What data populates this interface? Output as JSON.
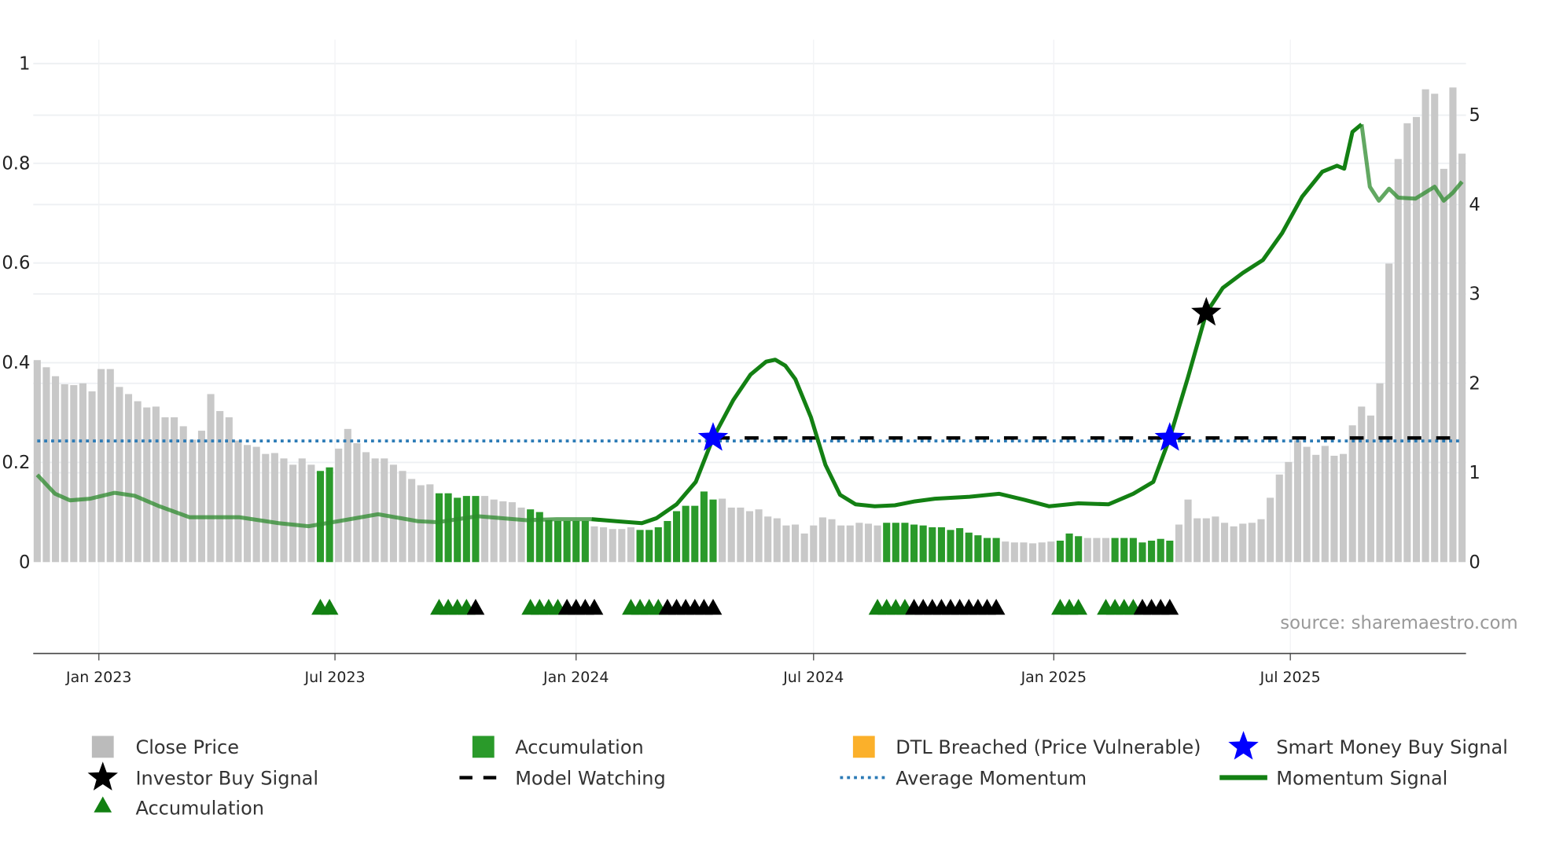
{
  "chart_data": {
    "type": "bar",
    "title": "",
    "source": "source: sharemaestro.com",
    "left_axis": {
      "label": "",
      "ylim": [
        0,
        1
      ],
      "ticks": [
        "0",
        "0.2",
        "0.4",
        "0.6",
        "0.8",
        "1"
      ],
      "tick_values": [
        0,
        0.2,
        0.4,
        0.6,
        0.8,
        1
      ]
    },
    "right_axis": {
      "label": "",
      "ylim": [
        0,
        5
      ],
      "ticks": [
        "0",
        "1",
        "2",
        "3",
        "4",
        "5"
      ],
      "tick_values": [
        0,
        1,
        2,
        3,
        4,
        5
      ]
    },
    "x_axis": {
      "unit": "week index",
      "range": [
        0,
        156
      ],
      "ticks": [
        "Jan 2023",
        "Jul 2023",
        "Jan 2024",
        "Jul 2024",
        "Jan 2025",
        "Jul 2025"
      ],
      "tick_values": [
        6.75,
        32.6,
        59.0,
        85.0,
        111.3,
        137.2
      ]
    },
    "grid": true,
    "legend_placement": "bottom",
    "colors": {
      "close": "#c8c8c8",
      "accumulation": "#2a9a2a",
      "dtl": "#fbb02a",
      "smart_money": "#0000ff",
      "investor": "#000000",
      "model_watching": "#000000",
      "avg_momentum": "#2c7bb6",
      "momentum": "#138013"
    },
    "close_price": [
      2.26,
      2.18,
      2.08,
      1.99,
      1.98,
      2.0,
      1.91,
      2.16,
      2.16,
      1.96,
      1.88,
      1.8,
      1.73,
      1.74,
      1.62,
      1.62,
      1.52,
      1.37,
      1.47,
      1.88,
      1.69,
      1.62,
      1.36,
      1.31,
      1.29,
      1.21,
      1.22,
      1.16,
      1.09,
      1.16,
      1.09,
      1.02,
      1.06,
      1.27,
      1.49,
      1.33,
      1.23,
      1.16,
      1.16,
      1.09,
      1.02,
      0.93,
      0.86,
      0.87,
      0.77,
      0.77,
      0.72,
      0.74,
      0.74,
      0.74,
      0.7,
      0.68,
      0.67,
      0.61,
      0.59,
      0.56,
      0.47,
      0.46,
      0.46,
      0.46,
      0.46,
      0.4,
      0.39,
      0.37,
      0.37,
      0.39,
      0.36,
      0.36,
      0.39,
      0.46,
      0.57,
      0.63,
      0.63,
      0.79,
      0.7,
      0.71,
      0.61,
      0.61,
      0.57,
      0.59,
      0.51,
      0.49,
      0.41,
      0.42,
      0.32,
      0.41,
      0.5,
      0.48,
      0.41,
      0.41,
      0.44,
      0.43,
      0.41,
      0.44,
      0.44,
      0.44,
      0.42,
      0.41,
      0.39,
      0.39,
      0.36,
      0.38,
      0.33,
      0.3,
      0.27,
      0.27,
      0.23,
      0.22,
      0.22,
      0.21,
      0.22,
      0.23,
      0.24,
      0.32,
      0.29,
      0.27,
      0.27,
      0.27,
      0.27,
      0.27,
      0.27,
      0.22,
      0.24,
      0.26,
      0.24,
      0.42,
      0.7,
      0.49,
      0.49,
      0.51,
      0.44,
      0.4,
      0.43,
      0.44,
      0.48,
      0.72,
      0.98,
      1.12,
      1.36,
      1.29,
      1.2,
      1.3,
      1.19,
      1.21,
      1.53,
      1.74,
      1.64,
      2.0,
      3.34,
      4.51,
      4.91,
      4.98,
      5.29,
      5.24,
      4.4,
      5.31,
      4.57
    ],
    "accumulation_bars": [
      31,
      32,
      44,
      45,
      46,
      47,
      48,
      54,
      55,
      56,
      57,
      58,
      59,
      60,
      66,
      67,
      68,
      69,
      70,
      71,
      72,
      73,
      74,
      93,
      94,
      95,
      96,
      97,
      98,
      99,
      100,
      101,
      102,
      103,
      104,
      105,
      112,
      113,
      114,
      118,
      119,
      120,
      121,
      122,
      123,
      124
    ],
    "momentum_signal": [
      [
        0,
        0.175
      ],
      [
        1.96,
        0.137
      ],
      [
        3.59,
        0.124
      ],
      [
        5.77,
        0.127
      ],
      [
        8.49,
        0.139
      ],
      [
        10.66,
        0.133
      ],
      [
        13.38,
        0.112
      ],
      [
        16.65,
        0.09
      ],
      [
        22.09,
        0.09
      ],
      [
        26.44,
        0.078
      ],
      [
        29.71,
        0.072
      ],
      [
        32.97,
        0.082
      ],
      [
        37.32,
        0.096
      ],
      [
        41.68,
        0.082
      ],
      [
        43.85,
        0.08
      ],
      [
        48.2,
        0.092
      ],
      [
        53.6,
        0.084
      ],
      [
        56.9,
        0.086
      ],
      [
        60.7,
        0.086
      ],
      [
        63.4,
        0.082
      ],
      [
        66.2,
        0.078
      ],
      [
        67.8,
        0.088
      ],
      [
        70.0,
        0.116
      ],
      [
        72.1,
        0.161
      ],
      [
        74.0,
        0.249
      ],
      [
        76.2,
        0.325
      ],
      [
        78.1,
        0.376
      ],
      [
        79.8,
        0.402
      ],
      [
        80.8,
        0.406
      ],
      [
        81.9,
        0.394
      ],
      [
        83.0,
        0.367
      ],
      [
        84.7,
        0.291
      ],
      [
        86.3,
        0.195
      ],
      [
        87.9,
        0.135
      ],
      [
        89.6,
        0.116
      ],
      [
        91.7,
        0.112
      ],
      [
        93.9,
        0.114
      ],
      [
        96.1,
        0.122
      ],
      [
        98.3,
        0.127
      ],
      [
        102.1,
        0.131
      ],
      [
        105.3,
        0.137
      ],
      [
        108.1,
        0.125
      ],
      [
        110.8,
        0.112
      ],
      [
        114.0,
        0.118
      ],
      [
        117.3,
        0.116
      ],
      [
        120.0,
        0.137
      ],
      [
        122.2,
        0.161
      ],
      [
        124.0,
        0.249
      ],
      [
        126.0,
        0.371
      ],
      [
        128.0,
        0.5
      ],
      [
        129.8,
        0.55
      ],
      [
        132.0,
        0.58
      ],
      [
        134.2,
        0.606
      ],
      [
        136.3,
        0.66
      ],
      [
        138.5,
        0.733
      ],
      [
        140.7,
        0.783
      ],
      [
        142.3,
        0.795
      ],
      [
        143.1,
        0.789
      ],
      [
        144.0,
        0.863
      ],
      [
        145.0,
        0.878
      ],
      [
        145.9,
        0.753
      ],
      [
        146.9,
        0.725
      ],
      [
        148.0,
        0.749
      ],
      [
        149.0,
        0.731
      ],
      [
        150.9,
        0.729
      ],
      [
        153.0,
        0.753
      ],
      [
        154.0,
        0.725
      ],
      [
        155.0,
        0.741
      ],
      [
        156.0,
        0.763
      ]
    ],
    "momentum_highlight_range": [
      60.7,
      145.0
    ],
    "average_momentum": {
      "value": 0.243,
      "range": [
        0,
        156
      ]
    },
    "model_watching": {
      "value": 0.249,
      "range": [
        74.3,
        156
      ]
    },
    "smart_money_buy_signals": [
      [
        74.0,
        0.249
      ],
      [
        124.0,
        0.249
      ]
    ],
    "investor_buy_signals": [
      [
        128.0,
        0.5
      ]
    ],
    "accumulation_markers": {
      "green": [
        31,
        32,
        44,
        45,
        46,
        47,
        54,
        55,
        56,
        57,
        65,
        66,
        67,
        68,
        92,
        93,
        94,
        95,
        112,
        113,
        114,
        117,
        118,
        119,
        120
      ],
      "black": [
        48,
        58,
        59,
        60,
        61,
        69,
        70,
        71,
        72,
        73,
        74,
        96,
        97,
        98,
        99,
        100,
        101,
        102,
        103,
        104,
        105,
        121,
        122,
        123,
        124
      ]
    },
    "legend": [
      {
        "label": "Close Price",
        "marker": "square-gray"
      },
      {
        "label": "Accumulation",
        "marker": "square-green"
      },
      {
        "label": "DTL Breached (Price Vulnerable)",
        "marker": "square-orange"
      },
      {
        "label": "Smart Money Buy Signal",
        "marker": "star-blue"
      },
      {
        "label": "Investor Buy Signal",
        "marker": "star-black"
      },
      {
        "label": "Model Watching",
        "marker": "dash-black"
      },
      {
        "label": "Average Momentum",
        "marker": "dot-blue"
      },
      {
        "label": "Momentum Signal",
        "marker": "line-green"
      },
      {
        "label": "Accumulation",
        "marker": "triangle-green"
      }
    ]
  }
}
